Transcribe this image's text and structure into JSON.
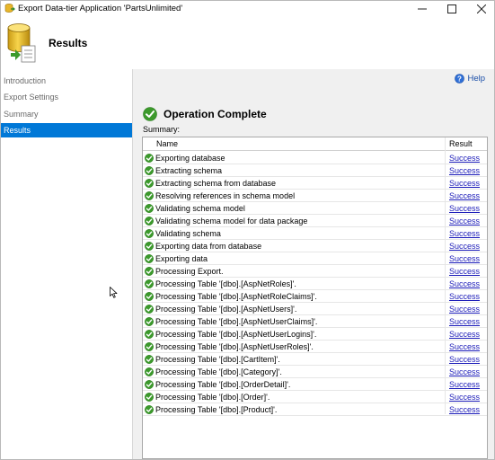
{
  "window": {
    "title": "Export Data-tier Application 'PartsUnlimited'"
  },
  "header": {
    "title": "Results"
  },
  "sidebar": {
    "items": [
      {
        "label": "Introduction",
        "active": false
      },
      {
        "label": "Export Settings",
        "active": false
      },
      {
        "label": "Summary",
        "active": false
      },
      {
        "label": "Results",
        "active": true
      }
    ]
  },
  "help": {
    "label": "Help"
  },
  "operation": {
    "title": "Operation Complete",
    "summary_label": "Summary:"
  },
  "table": {
    "columns": [
      "Name",
      "Result"
    ],
    "rows": [
      {
        "name": "Exporting database",
        "result": "Success"
      },
      {
        "name": "Extracting schema",
        "result": "Success"
      },
      {
        "name": "Extracting schema from database",
        "result": "Success"
      },
      {
        "name": "Resolving references in schema model",
        "result": "Success"
      },
      {
        "name": "Validating schema model",
        "result": "Success"
      },
      {
        "name": "Validating schema model for data package",
        "result": "Success"
      },
      {
        "name": "Validating schema",
        "result": "Success"
      },
      {
        "name": "Exporting data from database",
        "result": "Success"
      },
      {
        "name": "Exporting data",
        "result": "Success"
      },
      {
        "name": "Processing Export.",
        "result": "Success"
      },
      {
        "name": "Processing Table '[dbo].[AspNetRoles]'.",
        "result": "Success"
      },
      {
        "name": "Processing Table '[dbo].[AspNetRoleClaims]'.",
        "result": "Success"
      },
      {
        "name": "Processing Table '[dbo].[AspNetUsers]'.",
        "result": "Success"
      },
      {
        "name": "Processing Table '[dbo].[AspNetUserClaims]'.",
        "result": "Success"
      },
      {
        "name": "Processing Table '[dbo].[AspNetUserLogins]'.",
        "result": "Success"
      },
      {
        "name": "Processing Table '[dbo].[AspNetUserRoles]'.",
        "result": "Success"
      },
      {
        "name": "Processing Table '[dbo].[CartItem]'.",
        "result": "Success"
      },
      {
        "name": "Processing Table '[dbo].[Category]'.",
        "result": "Success"
      },
      {
        "name": "Processing Table '[dbo].[OrderDetail]'.",
        "result": "Success"
      },
      {
        "name": "Processing Table '[dbo].[Order]'.",
        "result": "Success"
      },
      {
        "name": "Processing Table '[dbo].[Product]'.",
        "result": "Success"
      }
    ]
  },
  "icons": {
    "app": "database-export-icon",
    "header": "database-icon",
    "help": "help-icon",
    "operation": "check-circle-icon",
    "row": "check-circle-icon"
  },
  "colors": {
    "accent": "#0078d7",
    "success_green": "#3c9a2c",
    "link": "#1a1ab8"
  }
}
